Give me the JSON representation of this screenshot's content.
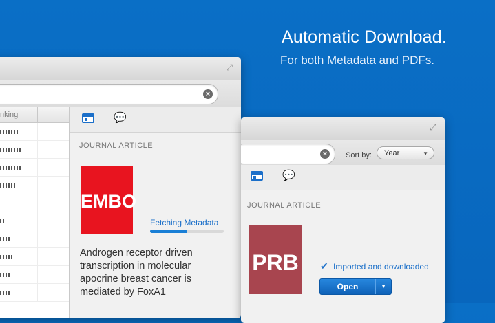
{
  "hero": {
    "headline": "Automatic Download.",
    "subline": "For both Metadata and PDFs."
  },
  "back_window": {
    "column_header": "nking",
    "rows": 10,
    "item": {
      "type_label": "JOURNAL ARTICLE",
      "cover_text": "EMBO",
      "cover_color": "#e8141f",
      "status": "Fetching Metadata",
      "progress": 0.5,
      "title": "Androgen receptor driven transcription in molecular apocrine breast cancer is mediated by FoxA1"
    }
  },
  "front_window": {
    "sort_label": "Sort by:",
    "sort_value": "Year",
    "item": {
      "type_label": "JOURNAL ARTICLE",
      "cover_text": "PRB",
      "cover_color": "#a8454f",
      "status": "Imported and downloaded",
      "open_label": "Open"
    }
  },
  "colors": {
    "background": "#0a6fc6",
    "accent": "#1a7fd6"
  }
}
